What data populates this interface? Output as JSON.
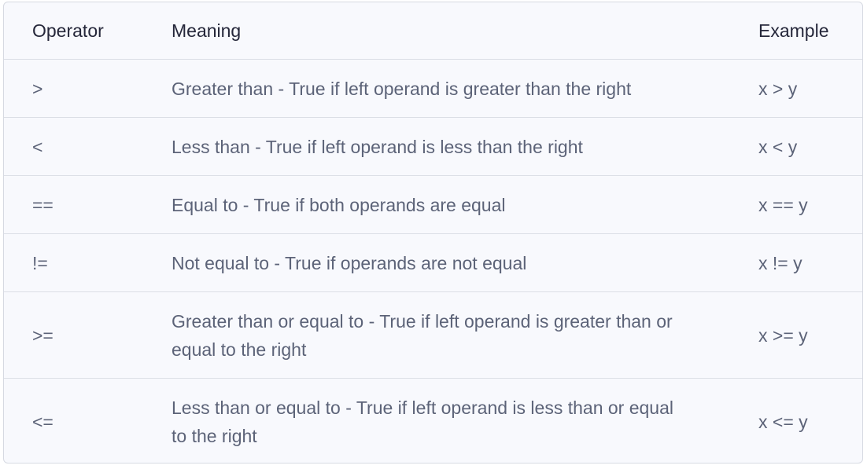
{
  "table": {
    "headers": {
      "operator": "Operator",
      "meaning": "Meaning",
      "example": "Example"
    },
    "rows": [
      {
        "operator": ">",
        "meaning": "Greater than - True if left operand is greater than the right",
        "example": "x > y"
      },
      {
        "operator": "<",
        "meaning": "Less than - True if left operand is less than the right",
        "example": "x < y"
      },
      {
        "operator": "==",
        "meaning": "Equal to - True if both operands are equal",
        "example": "x == y"
      },
      {
        "operator": "!=",
        "meaning": "Not equal to - True if operands are not equal",
        "example": "x != y"
      },
      {
        "operator": ">=",
        "meaning": "Greater than or equal to - True if left operand is greater than or equal to the right",
        "example": "x >= y"
      },
      {
        "operator": "<=",
        "meaning": "Less than or equal to - True if left operand is less than or equal to the right",
        "example": "x <= y"
      }
    ]
  },
  "colors": {
    "background": "#f8f9fd",
    "border": "#dcdfe6",
    "header_text": "#25273a",
    "body_text": "#5c6378"
  }
}
